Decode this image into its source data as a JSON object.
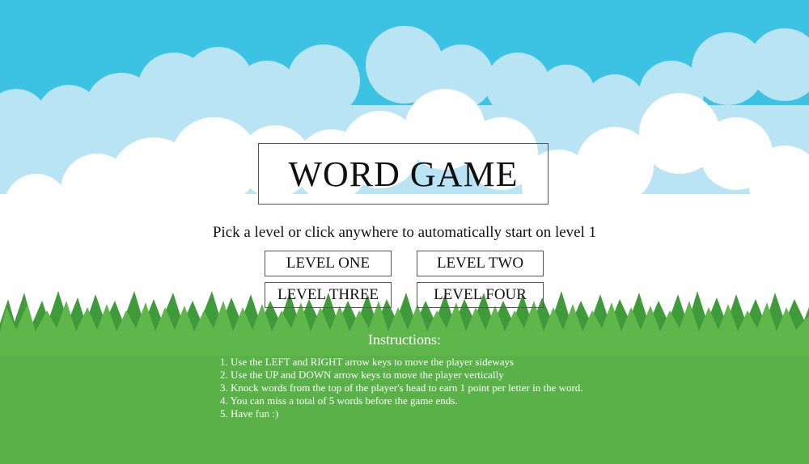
{
  "game": {
    "title": "WORD GAME",
    "subtitle": "Pick a level or click anywhere to automatically start on level 1",
    "levels": [
      {
        "label": "LEVEL ONE"
      },
      {
        "label": "LEVEL TWO"
      },
      {
        "label": "LEVEL THREE"
      },
      {
        "label": "LEVEL FOUR"
      }
    ],
    "instructions": {
      "heading": "Instructions:",
      "items": [
        "1. Use the LEFT and RIGHT arrow keys to move the player sideways",
        "2. Use the UP and DOWN arrow keys to move the player vertically",
        "3. Knock words from the top of the player's head to earn 1 point per letter in the word.",
        "4. You can miss a total of 5 words before the game ends.",
        "5. Have fun :)"
      ]
    }
  },
  "colors": {
    "sky": "#3cc3e3",
    "cloud_back": "#b9e4f4",
    "cloud_front": "#ffffff",
    "grass_light": "#5fb64b",
    "grass_dark": "#3f9a3a"
  }
}
